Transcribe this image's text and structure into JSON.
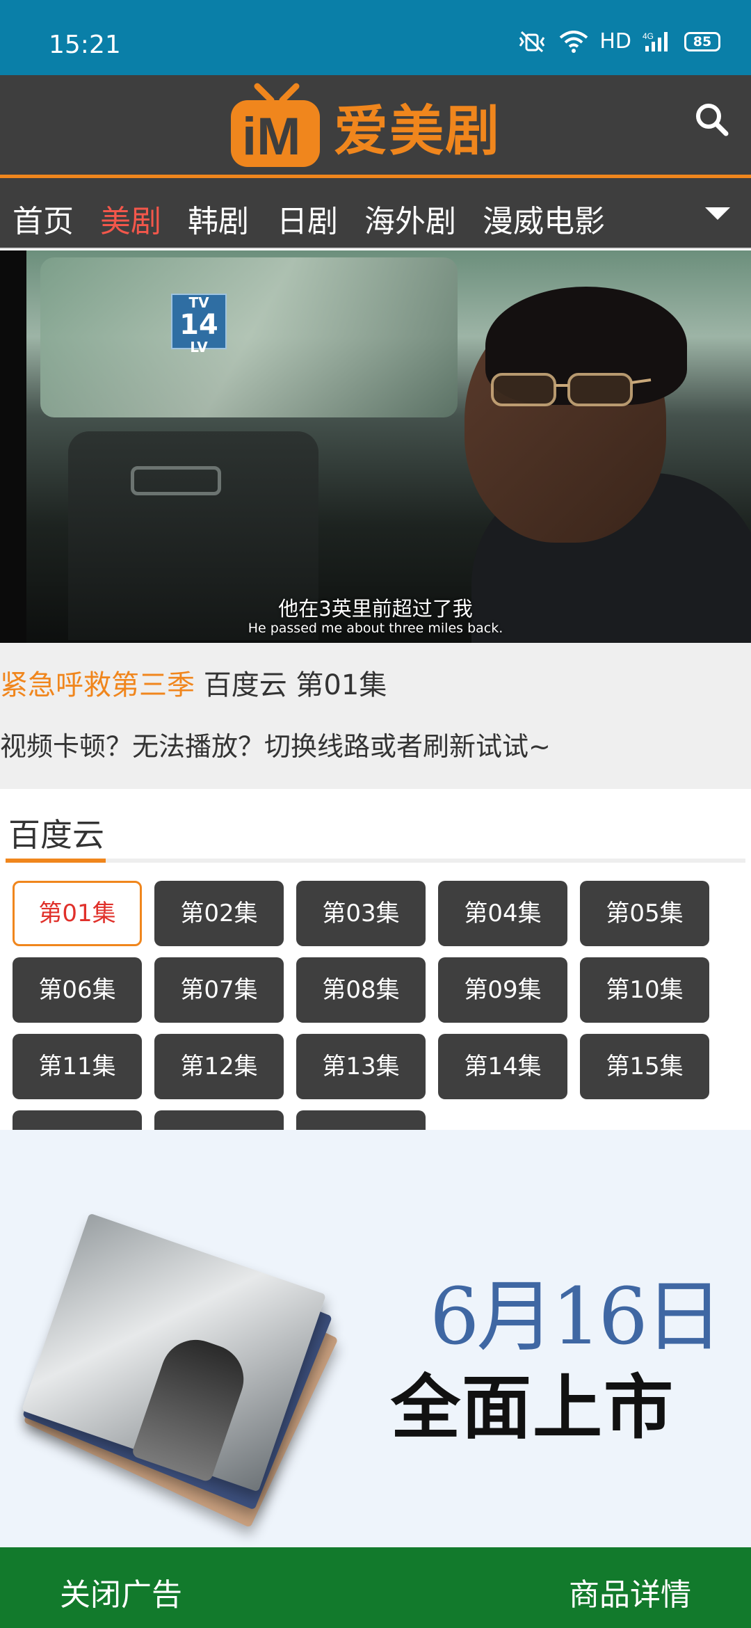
{
  "status_bar": {
    "time": "15:21",
    "network_label": "HD",
    "network_type": "4G",
    "battery": "85"
  },
  "header": {
    "logo_text": "爱美剧",
    "logo_colors": {
      "accent": "#f0861d",
      "background": "#3e3e3e"
    }
  },
  "nav": {
    "items": [
      {
        "label": "首页",
        "active": false
      },
      {
        "label": "美剧",
        "active": true
      },
      {
        "label": "韩剧",
        "active": false
      },
      {
        "label": "日剧",
        "active": false
      },
      {
        "label": "海外剧",
        "active": false
      },
      {
        "label": "漫威电影",
        "active": false
      }
    ],
    "active_color": "#f3574b"
  },
  "video": {
    "rating_badge": {
      "top": "14",
      "bottom": "LV",
      "prefix": "TV"
    },
    "subtitle_cn": "他在3英里前超过了我",
    "subtitle_en": "He passed me about three miles back."
  },
  "info": {
    "series_title": "紧急呼救第三季",
    "source_episode": " 百度云 第01集",
    "tip": "视频卡顿？无法播放？切换线路或者刷新试试~"
  },
  "episodes": {
    "source_tab": "百度云",
    "list": [
      "第01集",
      "第02集",
      "第03集",
      "第04集",
      "第05集",
      "第06集",
      "第07集",
      "第08集",
      "第09集",
      "第10集",
      "第11集",
      "第12集",
      "第13集",
      "第14集",
      "第15集",
      "",
      "",
      ""
    ],
    "active_index": 0
  },
  "ad": {
    "date": "6月16日",
    "slogan": "全面上市"
  },
  "bottom_bar": {
    "close_ad": "关闭广告",
    "product_detail": "商品详情",
    "color": "#127a2c"
  }
}
